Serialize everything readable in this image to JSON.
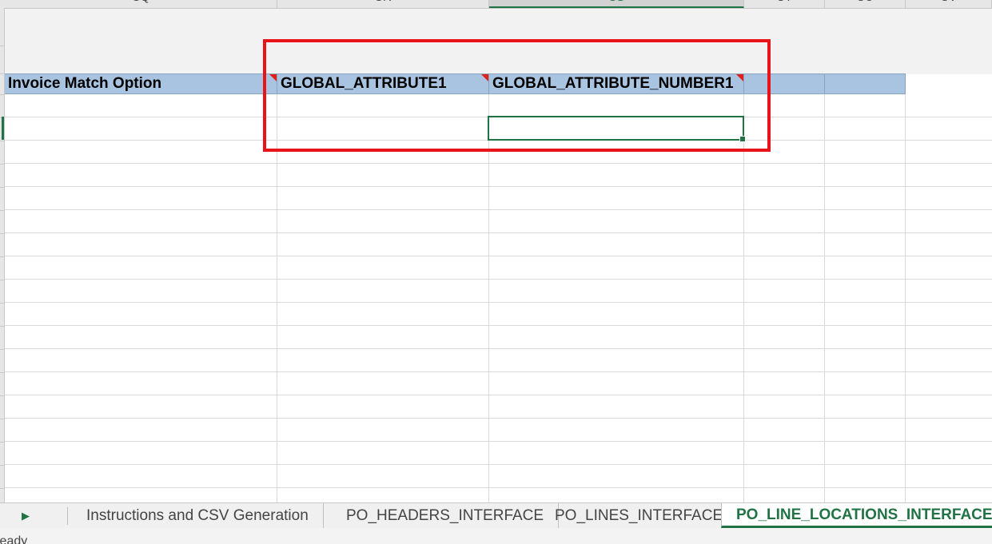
{
  "column_headers": [
    "CQ",
    "CR",
    "CS",
    "CT",
    "CU",
    "CV"
  ],
  "selected_column": "CS",
  "header_row": {
    "cells": [
      "Invoice Match Option",
      "GLOBAL_ATTRIBUTE1",
      "GLOBAL_ATTRIBUTE_NUMBER1",
      "",
      "",
      ""
    ]
  },
  "sheet_tabs": [
    {
      "label": "Instructions and CSV Generation",
      "active": false
    },
    {
      "label": "PO_HEADERS_INTERFACE",
      "active": false
    },
    {
      "label": "PO_LINES_INTERFACE",
      "active": false
    },
    {
      "label": "PO_LINE_LOCATIONS_INTERFACE",
      "active": true
    }
  ],
  "nav": {
    "next_icon": "triangle-right-icon",
    "next_glyph": "▶"
  },
  "status": {
    "text": "Ready"
  },
  "colors": {
    "header_fill": "#a8c4e0",
    "selection": "#217346",
    "highlight_box": "#e8141a",
    "comment_indicator": "#e0211b"
  }
}
